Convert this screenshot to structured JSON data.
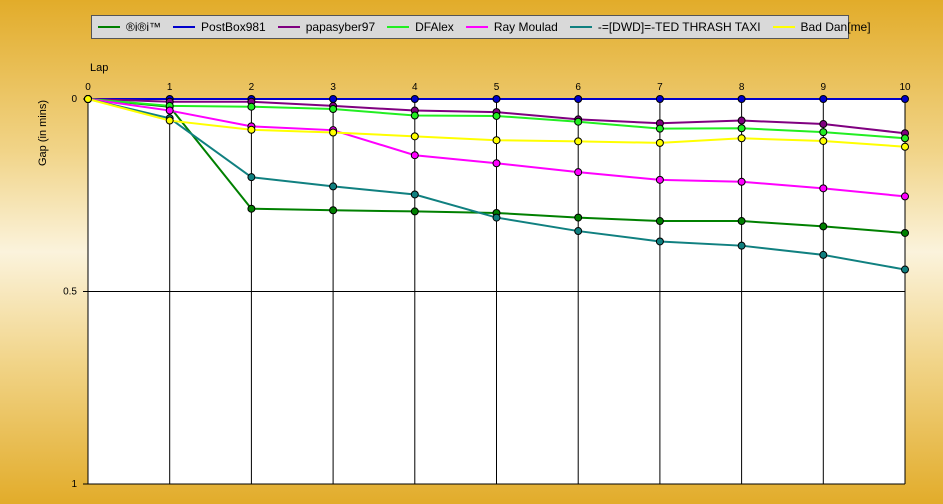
{
  "chart_data": {
    "type": "line",
    "xlabel": "Lap",
    "ylabel": "Gap (in mins)",
    "x": [
      0,
      1,
      2,
      3,
      4,
      5,
      6,
      7,
      8,
      9,
      10
    ],
    "xlim": [
      0,
      10
    ],
    "ylim": [
      0,
      1
    ],
    "y_inverted": true,
    "y_ticks": [
      0,
      0.5,
      1
    ],
    "y_tick_labels": [
      "0",
      "0.5",
      "1"
    ],
    "x_tick_labels": [
      "0",
      "1",
      "2",
      "3",
      "4",
      "5",
      "6",
      "7",
      "8",
      "9",
      "10"
    ],
    "legend_position": "top",
    "grid": "vertical lines at each lap, horizontal line at 0.5",
    "series": [
      {
        "name": "®i®i™",
        "color": "#008000",
        "values": [
          0,
          0.02,
          0.285,
          0.289,
          0.292,
          0.296,
          0.308,
          0.317,
          0.317,
          0.331,
          0.348
        ]
      },
      {
        "name": "PostBox981",
        "color": "#0000cc",
        "values": [
          0,
          0,
          0,
          0,
          0,
          0,
          0,
          0,
          0,
          0,
          0
        ]
      },
      {
        "name": "papasyber97",
        "color": "#800080",
        "values": [
          0,
          0.007,
          0.007,
          0.018,
          0.03,
          0.034,
          0.053,
          0.063,
          0.056,
          0.065,
          0.089
        ]
      },
      {
        "name": "DFAlex",
        "color": "#22ee22",
        "values": [
          0,
          0.018,
          0.02,
          0.026,
          0.043,
          0.044,
          0.059,
          0.077,
          0.076,
          0.086,
          0.102
        ]
      },
      {
        "name": "Ray Moulad",
        "color": "#ff00ff",
        "values": [
          0,
          0.03,
          0.071,
          0.081,
          0.146,
          0.167,
          0.19,
          0.21,
          0.215,
          0.232,
          0.253
        ]
      },
      {
        "name": "-=[DWD]=-TED THRASH TAXI",
        "color": "#108080",
        "values": [
          0,
          0.05,
          0.203,
          0.227,
          0.248,
          0.308,
          0.343,
          0.37,
          0.381,
          0.405,
          0.443
        ]
      },
      {
        "name": "Bad Dan[me]",
        "color": "#ffff00",
        "values": [
          0,
          0.056,
          0.08,
          0.087,
          0.097,
          0.107,
          0.11,
          0.114,
          0.102,
          0.109,
          0.124
        ]
      }
    ]
  }
}
